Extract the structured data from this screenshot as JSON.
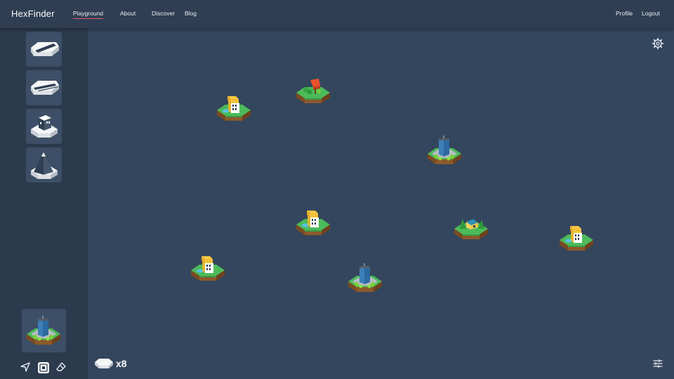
{
  "brand": "HexFinder",
  "nav": {
    "left": [
      {
        "label": "Playground",
        "active": true
      },
      {
        "label": "About"
      },
      {
        "label": "Discover"
      },
      {
        "label": "Blog"
      }
    ],
    "right": [
      {
        "label": "Profile"
      },
      {
        "label": "Logout"
      }
    ]
  },
  "palette": {
    "tiles": [
      "road-straight-tile",
      "road-double-tile",
      "building-tile",
      "mountain-tile"
    ],
    "selected": "skyscraper-tile"
  },
  "tools": [
    "pointer-tool",
    "stamp-tool",
    "eraser-tool"
  ],
  "board": {
    "tiles_remaining": "x8",
    "tiles": [
      {
        "type": "house"
      },
      {
        "type": "red-tree"
      },
      {
        "type": "skyscraper"
      },
      {
        "type": "house"
      },
      {
        "type": "bungalow"
      },
      {
        "type": "house"
      },
      {
        "type": "house"
      },
      {
        "type": "skyscraper"
      }
    ]
  },
  "colors": {
    "background": "#34465d",
    "topbar": "#2f3e52",
    "sidebar": "#2b3a4d",
    "accent": "#e65a74",
    "grass": "#4cbb5a",
    "soil": "#8b5a2b"
  }
}
